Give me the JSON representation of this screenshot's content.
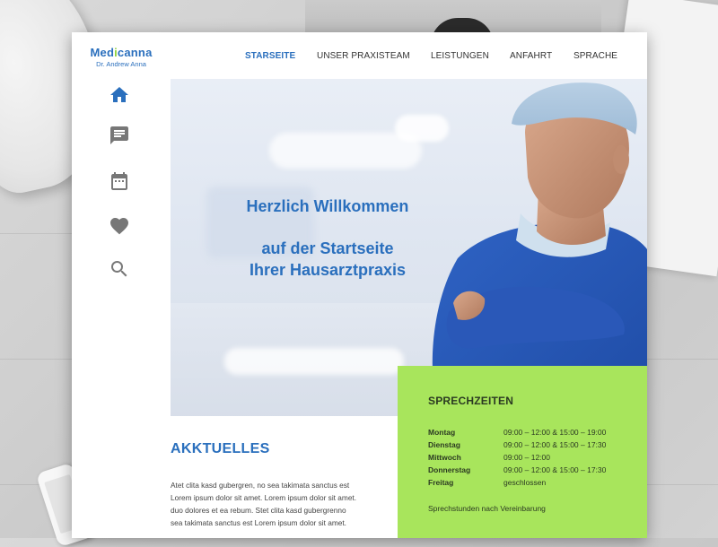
{
  "brand": {
    "name_part1": "Med",
    "name_mark": "i",
    "name_part2": "canna",
    "subtitle": "Dr. Andrew Anna",
    "color": "#2a6fbd",
    "accent": "#8fd43b"
  },
  "sidebar": {
    "items": [
      {
        "icon": "home-icon"
      },
      {
        "icon": "message-icon"
      },
      {
        "icon": "calendar-icon"
      },
      {
        "icon": "heart-icon"
      },
      {
        "icon": "search-icon"
      }
    ]
  },
  "nav": {
    "items": [
      {
        "label": "STARSEITE",
        "active": true
      },
      {
        "label": "UNSER PRAXISTEAM",
        "active": false
      },
      {
        "label": "LEISTUNGEN",
        "active": false
      },
      {
        "label": "ANFAHRT",
        "active": false
      },
      {
        "label": "SPRACHE",
        "active": false
      }
    ]
  },
  "hero": {
    "line1": "Herzlich Willkommen",
    "line2": "auf der Startseite",
    "line3": "Ihrer Hausarztpraxis"
  },
  "hours": {
    "title": "SPRECHZEITEN",
    "background": "#a8e55c",
    "rows": [
      {
        "day": "Montag",
        "time": "09:00 – 12:00 & 15:00 – 19:00"
      },
      {
        "day": "Dienstag",
        "time": "09:00 – 12:00 & 15:00 – 17:30"
      },
      {
        "day": "Mittwoch",
        "time": "09:00 – 12:00"
      },
      {
        "day": "Donnerstag",
        "time": "09:00 – 12:00 & 15:00 – 17:30"
      },
      {
        "day": "Freitag",
        "time": "geschlossen"
      }
    ],
    "note": "Sprechstunden nach Vereinbarung"
  },
  "news": {
    "title": "AKKTUELLES",
    "lines": [
      "Atet clita kasd gubergren, no sea takimata sanctus est",
      "Lorem ipsum dolor sit amet. Lorem ipsum dolor sit amet.",
      "duo dolores et ea rebum. Stet clita kasd gubergrenno",
      "sea takimata sanctus est Lorem ipsum dolor sit amet."
    ]
  }
}
